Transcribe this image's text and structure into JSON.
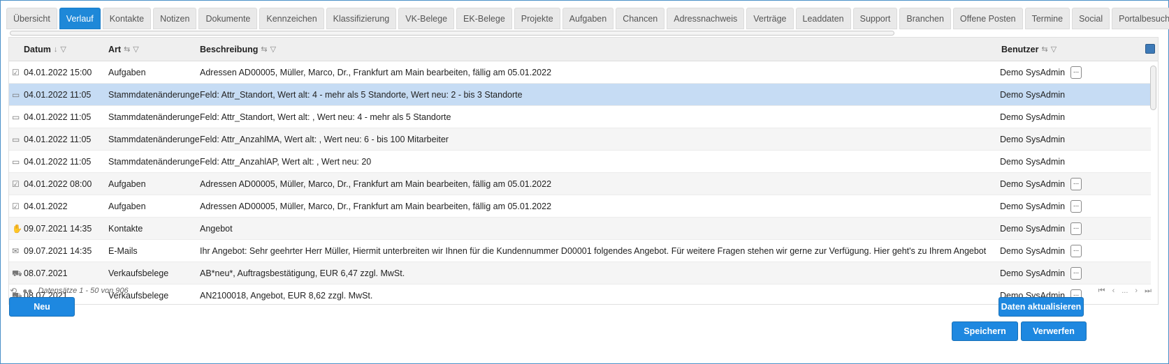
{
  "tabs": [
    "Übersicht",
    "Verlauf",
    "Kontakte",
    "Notizen",
    "Dokumente",
    "Kennzeichen",
    "Klassifizierung",
    "VK-Belege",
    "EK-Belege",
    "Projekte",
    "Aufgaben",
    "Chancen",
    "Adressnachweis",
    "Verträge",
    "Leaddaten",
    "Support",
    "Branchen",
    "Offene Posten",
    "Termine",
    "Social",
    "Portalbesuche"
  ],
  "active_tab": 1,
  "grid": {
    "headers": {
      "datum": "Datum",
      "art": "Art",
      "beschreibung": "Beschreibung",
      "benutzer": "Benutzer"
    },
    "rows": [
      {
        "icon": "☑",
        "icon_name": "task-icon",
        "datum": "04.01.2022 15:00",
        "art": "Aufgaben",
        "beschreibung": "Adressen AD00005, Müller, Marco, Dr., Frankfurt am Main bearbeiten, fällig am 05.01.2022",
        "benutzer": "Demo SysAdmin",
        "more": "...",
        "selected": false
      },
      {
        "icon": "▭",
        "icon_name": "master-data-icon",
        "datum": "04.01.2022 11:05",
        "art": "Stammdatenänderungen",
        "beschreibung": "Feld: Attr_Standort, Wert alt: 4 - mehr als 5 Standorte, Wert neu: 2 - bis 3 Standorte",
        "benutzer": "Demo SysAdmin",
        "more": "",
        "selected": true
      },
      {
        "icon": "▭",
        "icon_name": "master-data-icon",
        "datum": "04.01.2022 11:05",
        "art": "Stammdatenänderungen",
        "beschreibung": "Feld: Attr_Standort, Wert alt: , Wert neu: 4 - mehr als 5 Standorte",
        "benutzer": "Demo SysAdmin",
        "more": "",
        "selected": false
      },
      {
        "icon": "▭",
        "icon_name": "master-data-icon",
        "datum": "04.01.2022 11:05",
        "art": "Stammdatenänderungen",
        "beschreibung": "Feld: Attr_AnzahlMA, Wert alt: , Wert neu: 6 - bis 100 Mitarbeiter",
        "benutzer": "Demo SysAdmin",
        "more": "",
        "selected": false
      },
      {
        "icon": "▭",
        "icon_name": "master-data-icon",
        "datum": "04.01.2022 11:05",
        "art": "Stammdatenänderungen",
        "beschreibung": "Feld: Attr_AnzahlAP, Wert alt: , Wert neu: 20",
        "benutzer": "Demo SysAdmin",
        "more": "",
        "selected": false
      },
      {
        "icon": "☑",
        "icon_name": "task-icon",
        "datum": "04.01.2022 08:00",
        "art": "Aufgaben",
        "beschreibung": "Adressen AD00005, Müller, Marco, Dr., Frankfurt am Main bearbeiten, fällig am 05.01.2022",
        "benutzer": "Demo SysAdmin",
        "more": "...",
        "selected": false
      },
      {
        "icon": "☑",
        "icon_name": "task-icon",
        "datum": "04.01.2022",
        "art": "Aufgaben",
        "beschreibung": "Adressen AD00005, Müller, Marco, Dr., Frankfurt am Main bearbeiten, fällig am 05.01.2022",
        "benutzer": "Demo SysAdmin",
        "more": "...",
        "selected": false
      },
      {
        "icon": "✋",
        "icon_name": "contact-icon",
        "datum": "09.07.2021 14:35",
        "art": "Kontakte",
        "beschreibung": "Angebot",
        "benutzer": "Demo SysAdmin",
        "more": "...",
        "selected": false
      },
      {
        "icon": "✉",
        "icon_name": "email-icon",
        "datum": "09.07.2021 14:35",
        "art": "E-Mails",
        "beschreibung": "Ihr Angebot: Sehr geehrter Herr Müller, Hiermit unterbreiten wir Ihnen für die Kundennummer D00001 folgendes Angebot. Für weitere Fragen stehen wir gerne zur Verfügung. Hier geht's zu Ihrem Angebot",
        "benutzer": "Demo SysAdmin",
        "more": "...",
        "selected": false
      },
      {
        "icon": "⛟",
        "icon_name": "truck-icon",
        "datum": "08.07.2021",
        "art": "Verkaufsbelege",
        "beschreibung": "AB*neu*, Auftragsbestätigung, EUR 6,47 zzgl. MwSt.",
        "benutzer": "Demo SysAdmin",
        "more": "...",
        "selected": false
      },
      {
        "icon": "⛟",
        "icon_name": "truck-icon",
        "datum": "08.07.2021",
        "art": "Verkaufsbelege",
        "beschreibung": "AN2100018, Angebot, EUR 8,62 zzgl. MwSt.",
        "benutzer": "Demo SysAdmin",
        "more": "...",
        "selected": false
      }
    ]
  },
  "status": {
    "records": "Datensätze 1 - 50 von 906",
    "pager": [
      "⏮",
      "‹",
      "...",
      "›",
      "⏭"
    ]
  },
  "buttons": {
    "new": "Neu",
    "refresh": "Daten aktualisieren",
    "save": "Speichern",
    "discard": "Verwerfen"
  },
  "colors": {
    "accent": "#1e88e0",
    "selected_row": "#c6dcf4"
  }
}
